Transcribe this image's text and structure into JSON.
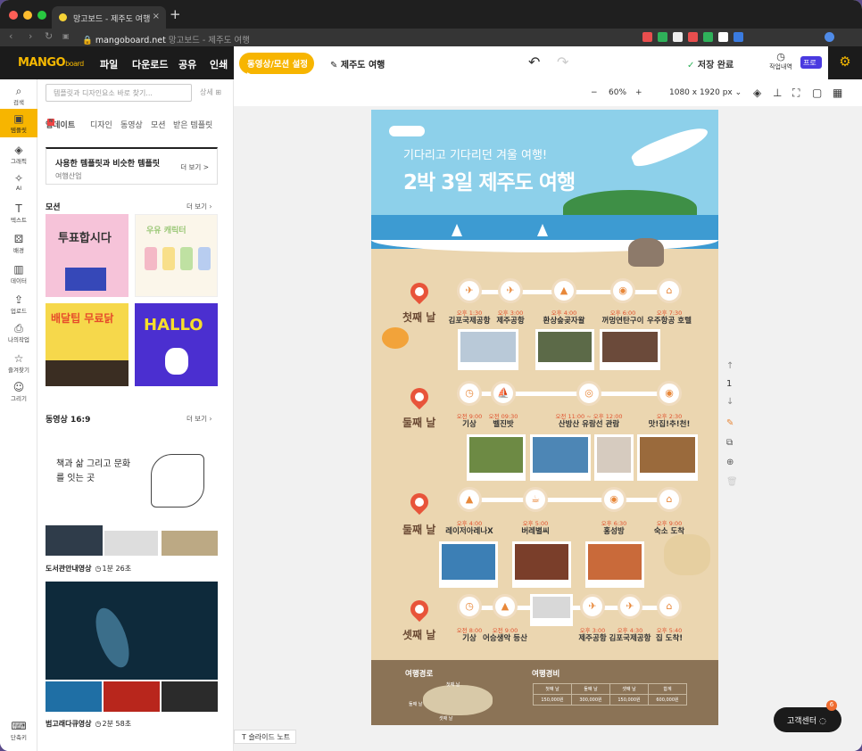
{
  "browser": {
    "tab_title": "망고보드 - 제주도 여행",
    "tab_close": "×",
    "new_tab": "+",
    "url_domain": "mangoboard.net",
    "url_rest": "망고보드 - 제주도 여행"
  },
  "app": {
    "logo": "MANGO",
    "logo_sub": "board",
    "menu": [
      "파일",
      "다운로드",
      "공유",
      "인쇄"
    ],
    "motion_btn": "동영상/모션 설정 ▸",
    "doc_title": "제주도 여행",
    "save_status": "저장 완료",
    "history": "작업내역",
    "pro": "프로",
    "help": "고객센터",
    "help_count": "6"
  },
  "rail": [
    {
      "icon": "search-icon",
      "label": "검색"
    },
    {
      "icon": "template-icon",
      "label": "템플릿"
    },
    {
      "icon": "graphic-icon",
      "label": "그래픽"
    },
    {
      "icon": "ai-icon",
      "label": "AI"
    },
    {
      "icon": "text-icon",
      "label": "텍스트"
    },
    {
      "icon": "background-icon",
      "label": "배경"
    },
    {
      "icon": "data-icon",
      "label": "데이터"
    },
    {
      "icon": "upload-icon",
      "label": "업로드"
    },
    {
      "icon": "my-work-icon",
      "label": "나의작업"
    },
    {
      "icon": "favorite-icon",
      "label": "즐겨찾기"
    },
    {
      "icon": "draw-icon",
      "label": "그리기"
    },
    {
      "icon": "keyboard-icon",
      "label": "단축키"
    }
  ],
  "panel": {
    "search_placeholder": "템플릿과 디자인요소 바로 찾기...",
    "detail": "상세",
    "tabs": [
      "업데이트",
      "디자인",
      "동영상",
      "모션",
      "받은 템플릿"
    ],
    "rec_title": "사용한 템플릿과 비슷한 템플릿",
    "rec_sub": "여행산업",
    "rec_more": "더 보기 >",
    "motion_title": "모션",
    "more": "더 보기",
    "video_title": "동영상 16:9",
    "thumbs": [
      "투표합시다",
      "우유 캐릭터",
      "배달팁 무료닭",
      "HALLO"
    ],
    "video1": {
      "title": "도서관안내영상",
      "dur": "1분 26초",
      "thumb_text": "책과 삶 그리고 문화를 잇는 곳"
    },
    "video2": {
      "title": "범고래다큐영상",
      "dur": "2분 58초"
    }
  },
  "toolbar": {
    "minus": "−",
    "zoom": "60%",
    "plus": "+",
    "size": "1080 x 1920 px ⌄"
  },
  "poster": {
    "subtitle": "기다리고 기다리던 겨울 여행!",
    "title": "2박 3일 제주도 여행",
    "days": [
      "첫째 날",
      "둘째 날",
      "둘째 날",
      "셋째 날"
    ],
    "row1": [
      {
        "t": "오후 1:30",
        "p": "김포국제공항"
      },
      {
        "t": "오후 3:00",
        "p": "제주공항"
      },
      {
        "t": "오후 4:00",
        "p": "환상숲곶자왈"
      },
      {
        "t": "오후 6:00",
        "p": "꺼멍연탄구이"
      },
      {
        "t": "오후 7:30",
        "p": "우주항공 호텔"
      }
    ],
    "row2": [
      {
        "t": "오전 9:00",
        "p": "기상"
      },
      {
        "t": "오전 09:30",
        "p": "벨진밧"
      },
      {
        "t": "오전 11:00 ~ 오후 12:00",
        "p": "산방산 유람선 관람"
      },
      {
        "t": "오후 2:30",
        "p": "맛!집!추!천!"
      }
    ],
    "row3": [
      {
        "t": "오후 4:00",
        "p": "레이저아레나X"
      },
      {
        "t": "오후 5:00",
        "p": "버레별씨"
      },
      {
        "t": "오후 6:30",
        "p": "홍성방"
      },
      {
        "t": "오후 9:00",
        "p": "숙소 도착"
      }
    ],
    "row4": [
      {
        "t": "오전 8:00",
        "p": "기상"
      },
      {
        "t": "오전 9:00",
        "p": "어승생악 등산"
      },
      {
        "t": "오후 3:00",
        "p": "제주공항"
      },
      {
        "t": "오후 4:30",
        "p": "김포국제공항"
      },
      {
        "t": "오후 5:40",
        "p": "집 도착!"
      }
    ],
    "route_title": "여행경로",
    "cost_title": "여행경비",
    "cost_head": [
      "첫째 날",
      "둘째 날",
      "셋째 날",
      "합계"
    ],
    "cost_vals": [
      "150,000원",
      "300,000원",
      "150,000원",
      "600,000원"
    ],
    "map_labels": [
      "첫째 날",
      "둘째 날",
      "셋째 날"
    ]
  },
  "page_nav": {
    "page": "1"
  },
  "notes": "슬라이드 노트"
}
